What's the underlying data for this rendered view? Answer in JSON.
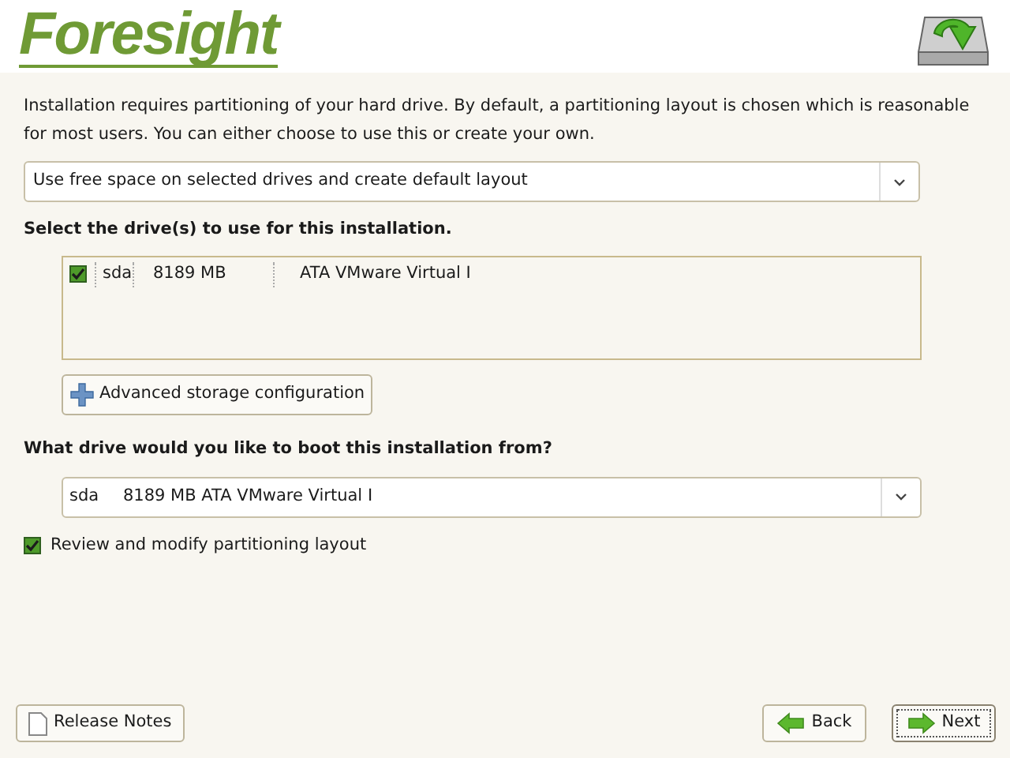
{
  "header": {
    "logo": "Foresight"
  },
  "intro": "Installation requires partitioning of your hard drive.  By default, a partitioning layout is chosen which is reasonable for most users.  You can either choose to use this or create your own.",
  "layout_select": {
    "value": "Use free space on selected drives and create default layout"
  },
  "drives_heading": "Select the drive(s) to use for this installation.",
  "drives": [
    {
      "checked": true,
      "name": "sda",
      "size": "8189 MB",
      "model": "ATA VMware Virtual I"
    }
  ],
  "advanced_button": "Advanced storage configuration",
  "boot_heading": "What drive would you like to boot this installation from?",
  "boot_select": {
    "device": "sda",
    "description": "8189 MB ATA VMware Virtual I"
  },
  "review": {
    "label": "Review and modify partitioning layout",
    "checked": true
  },
  "buttons": {
    "release_notes": "Release Notes",
    "back": "Back",
    "next": "Next"
  }
}
